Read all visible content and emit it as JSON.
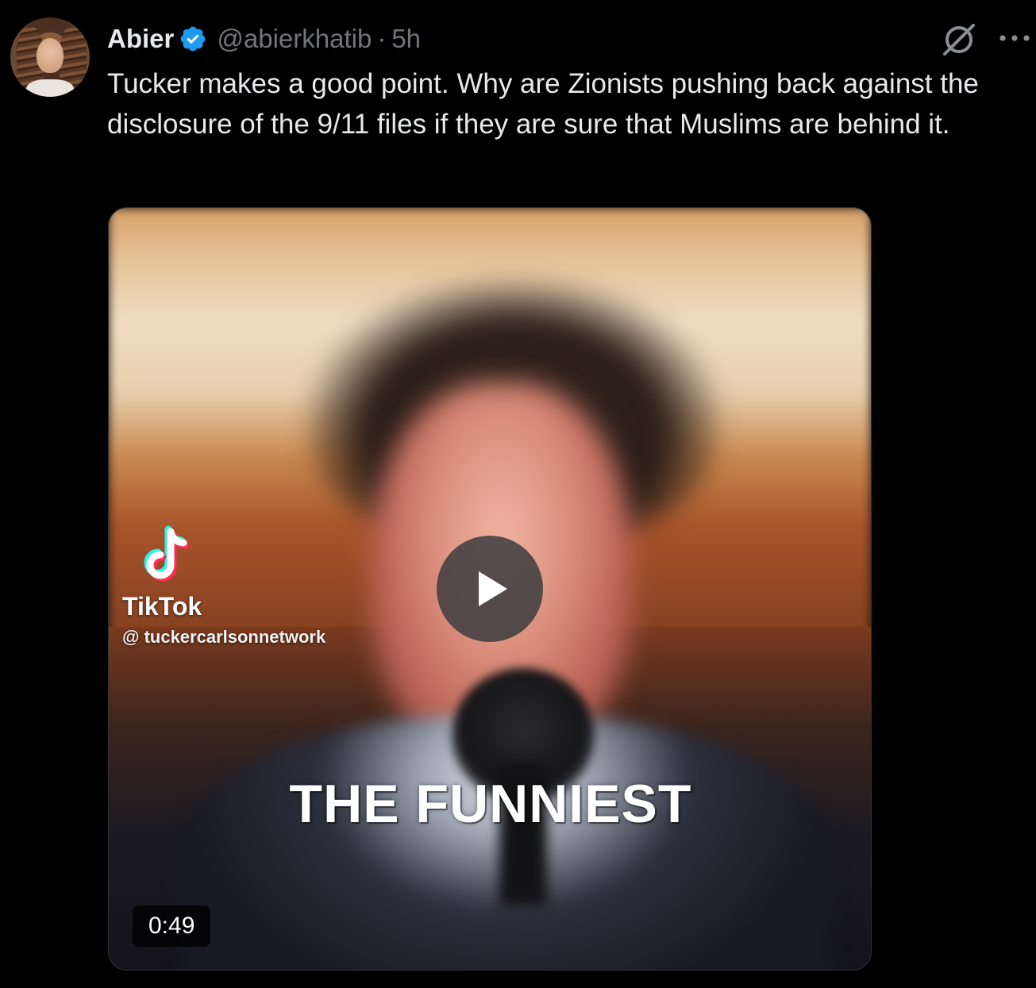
{
  "author": {
    "name": "Abier",
    "handle": "@abierkhatib",
    "separator": "·",
    "time": "5h"
  },
  "post": {
    "text": "Tucker makes a good point. Why are Zionists pushing back against the disclosure of the 9/11 files if they are sure that Muslims are behind it."
  },
  "media": {
    "watermark_brand": "TikTok",
    "watermark_handle": "@ tuckercarlsonnetwork",
    "caption": "THE FUNNIEST",
    "duration": "0:49"
  },
  "icons": {
    "verified": "verified-badge-icon",
    "grok": "grok-icon",
    "more": "more-icon",
    "play": "play-icon",
    "tiktok": "tiktok-icon"
  },
  "colors": {
    "background": "#000000",
    "text": "#e7e9ea",
    "secondary": "#71767b",
    "verified": "#1d9bf0"
  }
}
